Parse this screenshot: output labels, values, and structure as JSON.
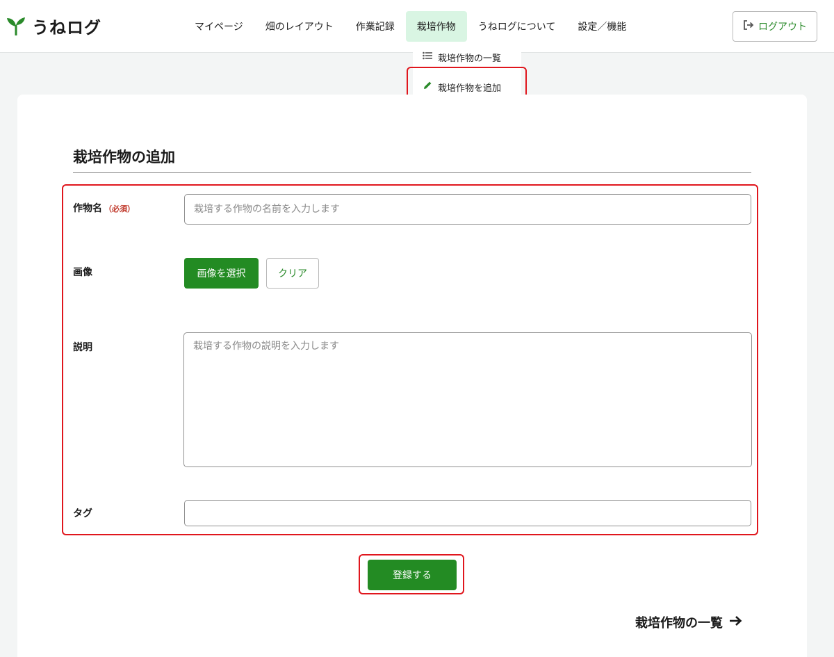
{
  "app": {
    "name": "うねログ"
  },
  "nav": {
    "items": [
      {
        "label": "マイページ"
      },
      {
        "label": "畑のレイアウト"
      },
      {
        "label": "作業記録"
      },
      {
        "label": "栽培作物"
      },
      {
        "label": "うねログについて"
      },
      {
        "label": "設定／機能"
      }
    ],
    "logout_label": "ログアウト"
  },
  "dropdown": {
    "items": [
      {
        "label": "栽培作物の一覧",
        "icon": "list-icon"
      },
      {
        "label": "栽培作物を追加",
        "icon": "pencil-icon"
      }
    ]
  },
  "form": {
    "title": "栽培作物の追加",
    "name_label": "作物名",
    "required_tag": "（必須）",
    "name_placeholder": "栽培する作物の名前を入力します",
    "image_label": "画像",
    "select_image_label": "画像を選択",
    "clear_label": "クリア",
    "description_label": "説明",
    "description_placeholder": "栽培する作物の説明を入力します",
    "tag_label": "タグ",
    "tag_value": "",
    "submit_label": "登録する"
  },
  "footer_link": {
    "label": "栽培作物の一覧",
    "icon": "arrow-right-icon"
  },
  "colors": {
    "accent": "#238b23",
    "active_nav_bg": "#d9f5e3",
    "highlight": "#e0161d",
    "required": "#c0392b"
  }
}
